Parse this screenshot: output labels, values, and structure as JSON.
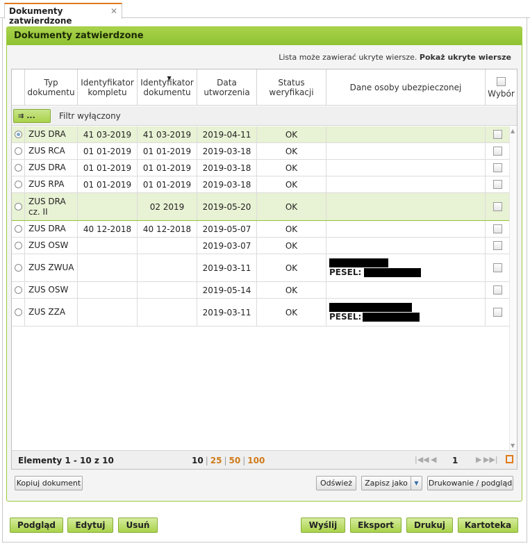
{
  "tab": {
    "title": "Dokumenty zatwierdzone",
    "close": "✕"
  },
  "panel": {
    "title": "Dokumenty zatwierdzone",
    "hidden_note": "Lista może zawierać ukryte wiersze.",
    "hidden_link": "Pokaż ukryte wiersze"
  },
  "columns": {
    "typ": "Typ dokumentu",
    "id_kompletu": "Identyfikator kompletu",
    "id_dokumentu": "Identyfikator dokumentu",
    "data": "Data utworzenia",
    "status": "Status weryfikacji",
    "dane": "Dane osoby ubezpieczonej",
    "wybor": "Wybór"
  },
  "filter": {
    "button": "...",
    "label": "Filtr wyłączony",
    "icon": "filter-arrows-icon"
  },
  "rows": [
    {
      "typ": "ZUS DRA",
      "id_kompletu": "41 03-2019",
      "id_dokumentu": "41 03-2019",
      "data": "2019-04-11",
      "status": "OK",
      "dane": "",
      "selected": true
    },
    {
      "typ": "ZUS RCA",
      "id_kompletu": "01 01-2019",
      "id_dokumentu": "01 01-2019",
      "data": "2019-03-18",
      "status": "OK",
      "dane": ""
    },
    {
      "typ": "ZUS DRA",
      "id_kompletu": "01 01-2019",
      "id_dokumentu": "01 01-2019",
      "data": "2019-03-18",
      "status": "OK",
      "dane": ""
    },
    {
      "typ": "ZUS RPA",
      "id_kompletu": "01 01-2019",
      "id_dokumentu": "01 01-2019",
      "data": "2019-03-18",
      "status": "OK",
      "dane": ""
    },
    {
      "typ": "ZUS DRA cz. II",
      "id_kompletu": "",
      "id_dokumentu": "02 2019",
      "data": "2019-05-20",
      "status": "OK",
      "dane": ""
    },
    {
      "typ": "ZUS DRA",
      "id_kompletu": "40 12-2018",
      "id_dokumentu": "40 12-2018",
      "data": "2019-05-07",
      "status": "OK",
      "dane": ""
    },
    {
      "typ": "ZUS OSW",
      "id_kompletu": "",
      "id_dokumentu": "",
      "data": "2019-03-07",
      "status": "OK",
      "dane": ""
    },
    {
      "typ": "ZUS ZWUA",
      "id_kompletu": "",
      "id_dokumentu": "",
      "data": "2019-03-11",
      "status": "OK",
      "dane": "",
      "pesel_label": "PESEL:"
    },
    {
      "typ": "ZUS OSW",
      "id_kompletu": "",
      "id_dokumentu": "",
      "data": "2019-05-14",
      "status": "OK",
      "dane": ""
    },
    {
      "typ": "ZUS ZZA",
      "id_kompletu": "",
      "id_dokumentu": "",
      "data": "2019-03-11",
      "status": "OK",
      "dane": "",
      "pesel_label": "PESEL:"
    }
  ],
  "pager": {
    "count": "Elementy 1 - 10 z 10",
    "sizes": [
      "10",
      "25",
      "50",
      "100"
    ],
    "active_size": "10",
    "page": "1"
  },
  "actions": {
    "copy": "Kopiuj dokument",
    "refresh": "Odśwież",
    "save_as": "Zapisz jako",
    "print_preview": "Drukowanie / podgląd"
  },
  "bottom_buttons": {
    "preview": "Podgląd",
    "edit": "Edytuj",
    "delete": "Usuń",
    "send": "Wyślij",
    "export": "Eksport",
    "print": "Drukuj",
    "card": "Kartoteka"
  },
  "colors": {
    "accent_green": "#a9d24a",
    "accent_orange": "#e07b1a",
    "row_highlight": "#e8f2d4"
  }
}
